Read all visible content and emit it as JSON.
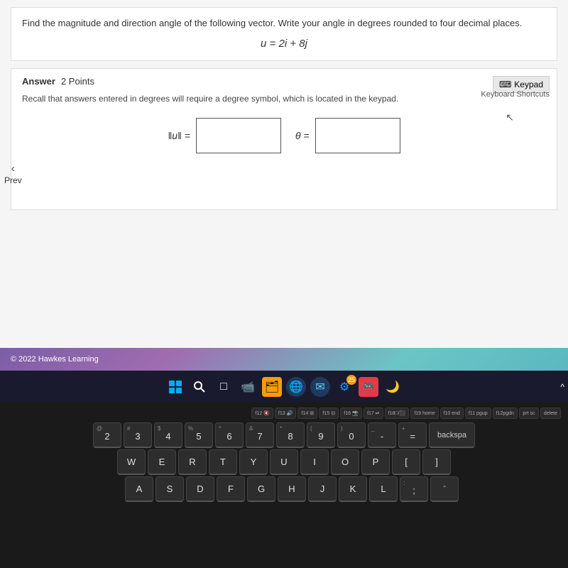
{
  "question": {
    "text": "Find the magnitude and direction angle of the following vector. Write your angle in degrees rounded to four decimal places.",
    "vector_equation": "u = 2i + 8j"
  },
  "answer": {
    "label": "Answer",
    "points": "2 Points",
    "recall_text": "Recall that answers entered in degrees will require a degree symbol, which is located in the keypad.",
    "keypad_button": "Keypad",
    "keyboard_shortcuts": "Keyboard Shortcuts",
    "norm_label": "‖u‖ =",
    "theta_label": "θ ="
  },
  "footer": {
    "copyright": "© 2022 Hawkes Learning"
  },
  "taskbar": {
    "icons": [
      "⊞",
      "🔍",
      "□",
      "📹",
      "🗂",
      "🌐",
      "✉",
      "⚙",
      "🎮",
      "🔴",
      "🌙"
    ]
  },
  "keyboard": {
    "fn_row": [
      "f12 🔇",
      "f13 🔊",
      "f14 ⊞",
      "f15 ⊟",
      "f16 📸",
      "f17 ⏯",
      "f18 □/⬛",
      "f19 home",
      "f10 end",
      "f11 pgup",
      "f12 pgdn",
      "prt sc",
      "delete"
    ],
    "number_row": [
      "2",
      "3",
      "4",
      "5",
      "6",
      "7",
      "8",
      "9",
      "0",
      "-",
      "=",
      "backspa"
    ],
    "qwerty_row": [
      "W",
      "E",
      "R",
      "T",
      "Y",
      "U",
      "I",
      "O",
      "P",
      "[",
      "]"
    ],
    "home_row": [
      "A",
      "S",
      "D",
      "F",
      "G",
      "H",
      "J",
      "K",
      "L",
      ";",
      "'"
    ]
  }
}
